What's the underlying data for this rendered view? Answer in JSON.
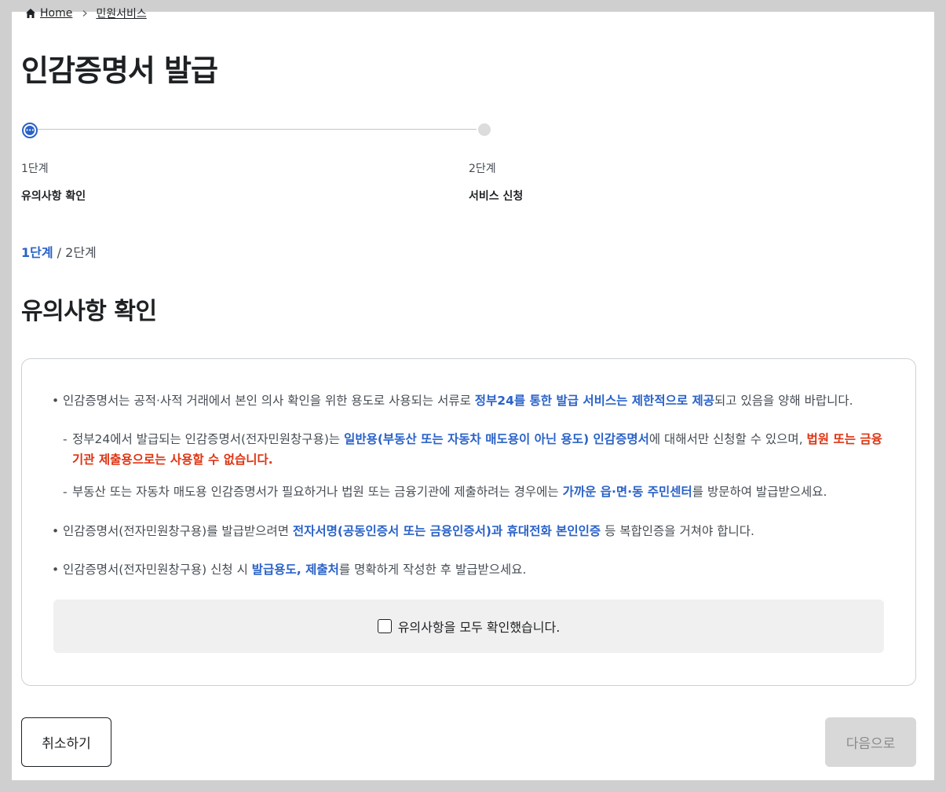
{
  "breadcrumb": {
    "home": "Home",
    "current": "민원서비스"
  },
  "page_title": "인감증명서 발급",
  "stepper": {
    "steps": [
      {
        "num": "1단계",
        "name": "유의사항 확인"
      },
      {
        "num": "2단계",
        "name": "서비스 신청"
      }
    ]
  },
  "step_count": {
    "current": "1단계",
    "separator": "/",
    "total": "2단계"
  },
  "section_title": "유의사항 확인",
  "notices": {
    "n1": {
      "a": "인감증명서는 공적·사적 거래에서 본인 의사 확인을 위한 용도로 사용되는 서류로 ",
      "b": "정부24를 통한 발급 서비스는 제한적으로 제공",
      "c": "되고 있음을 양해 바랍니다."
    },
    "s1": {
      "a": "정부24에서 발급되는 인감증명서(전자민원창구용)는 ",
      "b": "일반용(부동산 또는 자동차 매도용이 아닌 용도) 인감증명서",
      "c": "에 대해서만 신청할 수 있으며, ",
      "d": "법원 또는 금융기관 제출용으로는 사용할 수 없습니다."
    },
    "s2": {
      "a": "부동산 또는 자동차 매도용 인감증명서가 필요하거나 법원 또는 금융기관에 제출하려는 경우에는 ",
      "b": "가까운 읍·면·동 주민센터",
      "c": "를 방문하여 발급받으세요."
    },
    "n2": {
      "a": "인감증명서(전자민원창구용)를 발급받으려면 ",
      "b": "전자서명(공동인증서 또는 금융인증서)과 휴대전화 본인인증",
      "c": " 등 복합인증을 거쳐야 합니다."
    },
    "n3": {
      "a": "인감증명서(전자민원창구용) 신청 시 ",
      "b": "발급용도, 제출처",
      "c": "를 명확하게 작성한 후 발급받으세요."
    },
    "bullet": "•",
    "dash": "-"
  },
  "agree_label": "유의사항을 모두 확인했습니다.",
  "buttons": {
    "cancel": "취소하기",
    "next": "다음으로"
  },
  "colors": {
    "accent": "#2a62c8",
    "warning": "#de3412",
    "disabled": "#d8d8d8"
  }
}
